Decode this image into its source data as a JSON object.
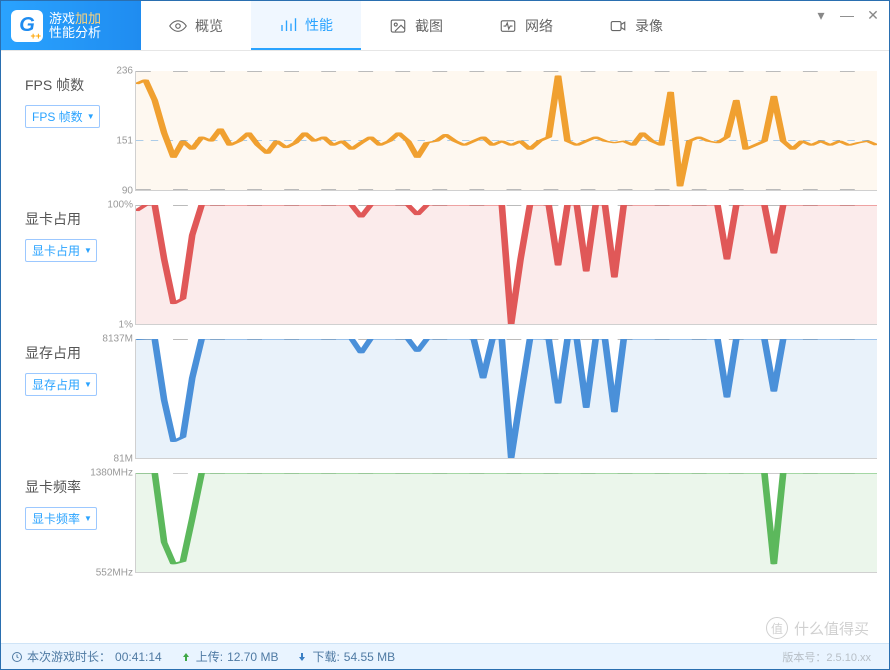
{
  "app": {
    "logo_line1_a": "游戏",
    "logo_line1_b": "加加",
    "logo_line2": "性能分析"
  },
  "tabs": {
    "overview": "概览",
    "performance": "性能",
    "screenshot": "截图",
    "network": "网络",
    "record": "录像"
  },
  "rows": {
    "fps": {
      "title": "FPS 帧数",
      "dropdown": "FPS 帧数",
      "y_top": "236",
      "y_mid": "151",
      "y_bot": "90"
    },
    "gpu_usage": {
      "title": "显卡占用",
      "dropdown": "显卡占用",
      "y_top": "100%",
      "y_bot": "1%"
    },
    "vram": {
      "title": "显存占用",
      "dropdown": "显存占用",
      "y_top": "8137M",
      "y_bot": "81M"
    },
    "gpu_clock": {
      "title": "显卡频率",
      "dropdown": "显卡频率",
      "y_top": "1380MHz",
      "y_bot": "552MHz"
    }
  },
  "status": {
    "duration_label": "本次游戏时长：",
    "duration": "00:41:14",
    "upload_label": "上传:",
    "upload": "12.70 MB",
    "download_label": "下载:",
    "download": "54.55 MB",
    "version_label": "版本号：2.5.10.xx"
  },
  "watermark": {
    "circle": "值",
    "text": "什么值得买"
  },
  "chart_data": [
    {
      "type": "line",
      "name": "fps",
      "title": "FPS 帧数",
      "ylim": [
        90,
        236
      ],
      "reference_line_at": 151,
      "color": "#f0a030",
      "values": [
        220,
        225,
        200,
        160,
        130,
        150,
        140,
        155,
        150,
        165,
        145,
        150,
        160,
        145,
        135,
        150,
        142,
        148,
        160,
        150,
        155,
        145,
        150,
        140,
        148,
        155,
        145,
        150,
        160,
        150,
        130,
        148,
        150,
        158,
        150,
        145,
        150,
        155,
        145,
        150,
        145,
        150,
        140,
        150,
        155,
        230,
        150,
        145,
        150,
        155,
        150,
        148,
        150,
        145,
        160,
        150,
        145,
        210,
        95,
        150,
        155,
        150,
        148,
        155,
        200,
        140,
        145,
        150,
        205,
        150,
        140,
        150,
        145,
        150,
        145,
        150,
        145,
        148,
        150,
        145
      ]
    },
    {
      "type": "area",
      "name": "gpu_usage",
      "title": "显卡占用",
      "ylim": [
        1,
        100
      ],
      "color": "#e05858",
      "values": [
        95,
        100,
        100,
        55,
        18,
        22,
        75,
        100,
        100,
        100,
        100,
        100,
        100,
        100,
        100,
        100,
        100,
        100,
        100,
        100,
        100,
        100,
        100,
        100,
        90,
        100,
        100,
        100,
        100,
        100,
        92,
        100,
        100,
        100,
        100,
        100,
        100,
        100,
        100,
        100,
        1,
        55,
        100,
        100,
        100,
        50,
        100,
        100,
        45,
        100,
        100,
        40,
        100,
        100,
        100,
        100,
        100,
        100,
        100,
        100,
        100,
        100,
        100,
        55,
        100,
        100,
        100,
        100,
        60,
        100,
        100,
        100,
        100,
        100,
        100,
        100,
        100,
        100,
        100,
        100
      ]
    },
    {
      "type": "area",
      "name": "vram",
      "title": "显存占用",
      "ylim": [
        81,
        8137
      ],
      "color": "#4a90d9",
      "values": [
        8100,
        8137,
        8137,
        4000,
        1200,
        1500,
        5500,
        8137,
        8137,
        8137,
        8137,
        8137,
        8137,
        8137,
        8137,
        8137,
        8137,
        8137,
        8137,
        8137,
        8137,
        8137,
        8137,
        8137,
        7200,
        8137,
        8137,
        8137,
        8137,
        8137,
        7300,
        8137,
        8137,
        8137,
        8137,
        8137,
        8137,
        5500,
        8137,
        8137,
        100,
        4200,
        8137,
        8137,
        8137,
        3800,
        8137,
        8137,
        3500,
        8137,
        8137,
        3200,
        8137,
        8137,
        8137,
        8137,
        8137,
        8137,
        8137,
        8137,
        8137,
        8137,
        8137,
        4200,
        8137,
        8137,
        8137,
        8137,
        4600,
        8137,
        8137,
        8137,
        8137,
        8137,
        8137,
        8137,
        8137,
        8137,
        8137,
        8137
      ]
    },
    {
      "type": "area",
      "name": "gpu_clock",
      "title": "显卡频率",
      "ylim": [
        552,
        1380
      ],
      "color": "#5cb85c",
      "values": [
        1380,
        1380,
        1380,
        800,
        620,
        640,
        1000,
        1380,
        1380,
        1380,
        1380,
        1380,
        1380,
        1380,
        1380,
        1380,
        1380,
        1380,
        1380,
        1380,
        1380,
        1380,
        1380,
        1380,
        1380,
        1380,
        1380,
        1380,
        1380,
        1380,
        1380,
        1380,
        1380,
        1380,
        1380,
        1380,
        1380,
        1380,
        1380,
        1380,
        1380,
        1380,
        1380,
        1380,
        1380,
        1380,
        1380,
        1380,
        1380,
        1380,
        1380,
        1380,
        1380,
        1380,
        1380,
        1380,
        1380,
        1380,
        1380,
        1380,
        1380,
        1380,
        1380,
        1380,
        1380,
        1380,
        1380,
        1380,
        620,
        1380,
        1380,
        1380,
        1380,
        1380,
        1380,
        1380,
        1380,
        1380,
        1380,
        1380
      ]
    }
  ]
}
